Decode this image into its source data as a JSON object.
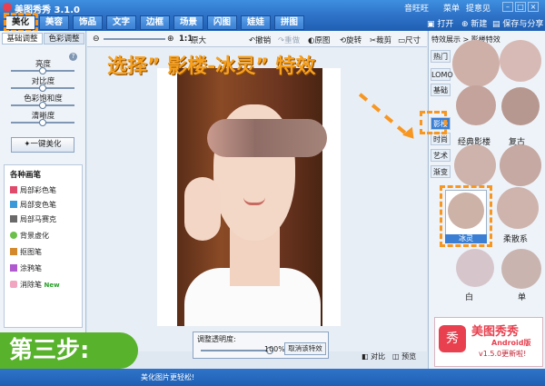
{
  "window": {
    "title": "美图秀秀 3.1.0",
    "account": "音旺旺",
    "menu": "菜单",
    "feedback": "提意见"
  },
  "tabs": [
    "美化",
    "美容",
    "饰品",
    "文字",
    "边框",
    "场景",
    "闪图",
    "娃娃",
    "拼图"
  ],
  "tabbar_actions": {
    "open": "打开",
    "new": "新建",
    "save": "保存与分享"
  },
  "left_panel": {
    "subtabs": [
      "基础调整",
      "色彩调整"
    ],
    "adjustments": [
      {
        "label": "亮度",
        "level": 0.5
      },
      {
        "label": "对比度",
        "level": 0.5
      },
      {
        "label": "色彩饱和度",
        "level": 0.5
      },
      {
        "label": "清晰度",
        "level": 0.5
      }
    ],
    "one_key": "一键美化",
    "brush_title": "各种画笔",
    "brushes": [
      "局部彩色笔",
      "局部变色笔",
      "局部马赛克",
      "背景虚化",
      "抠图笔",
      "涂鸦笔",
      "消除笔"
    ],
    "new_badge": "New"
  },
  "toolbar": {
    "ratio": "1:1",
    "original": "原大",
    "undo": "撤销",
    "redo": "重做",
    "original_image": "原图",
    "rotate": "旋转",
    "crop": "裁剪",
    "size": "尺寸"
  },
  "annotation": {
    "heading": "选择” 影楼-冰灵” 特效",
    "step": "第三步:"
  },
  "opacity_panel": {
    "label": "调整透明度:",
    "value": "100%",
    "level": 1.0,
    "cancel": "取消该特效"
  },
  "canvas_footer": {
    "compare": "对比",
    "preview": "预览"
  },
  "right_panel": {
    "header": "特效展示 > 影楼特效",
    "categories": [
      "热门",
      "LOMO",
      "基础",
      "影楼",
      "时尚",
      "艺术",
      "渐变"
    ],
    "active_category": "影楼",
    "effects": [
      "经典影楼",
      "复古",
      "冰灵",
      "柔散系",
      "白",
      "单"
    ],
    "selected_effect": "冰灵",
    "ad_title": "美图秀秀",
    "ad_sub": "Android版",
    "ad_version": "v1.5.0更新啦!"
  },
  "status": {
    "tip": "美化图片更轻松!"
  },
  "colors": {
    "accent": "#3a7fd3",
    "highlight": "#f79722",
    "step_green": "#58b22c"
  }
}
